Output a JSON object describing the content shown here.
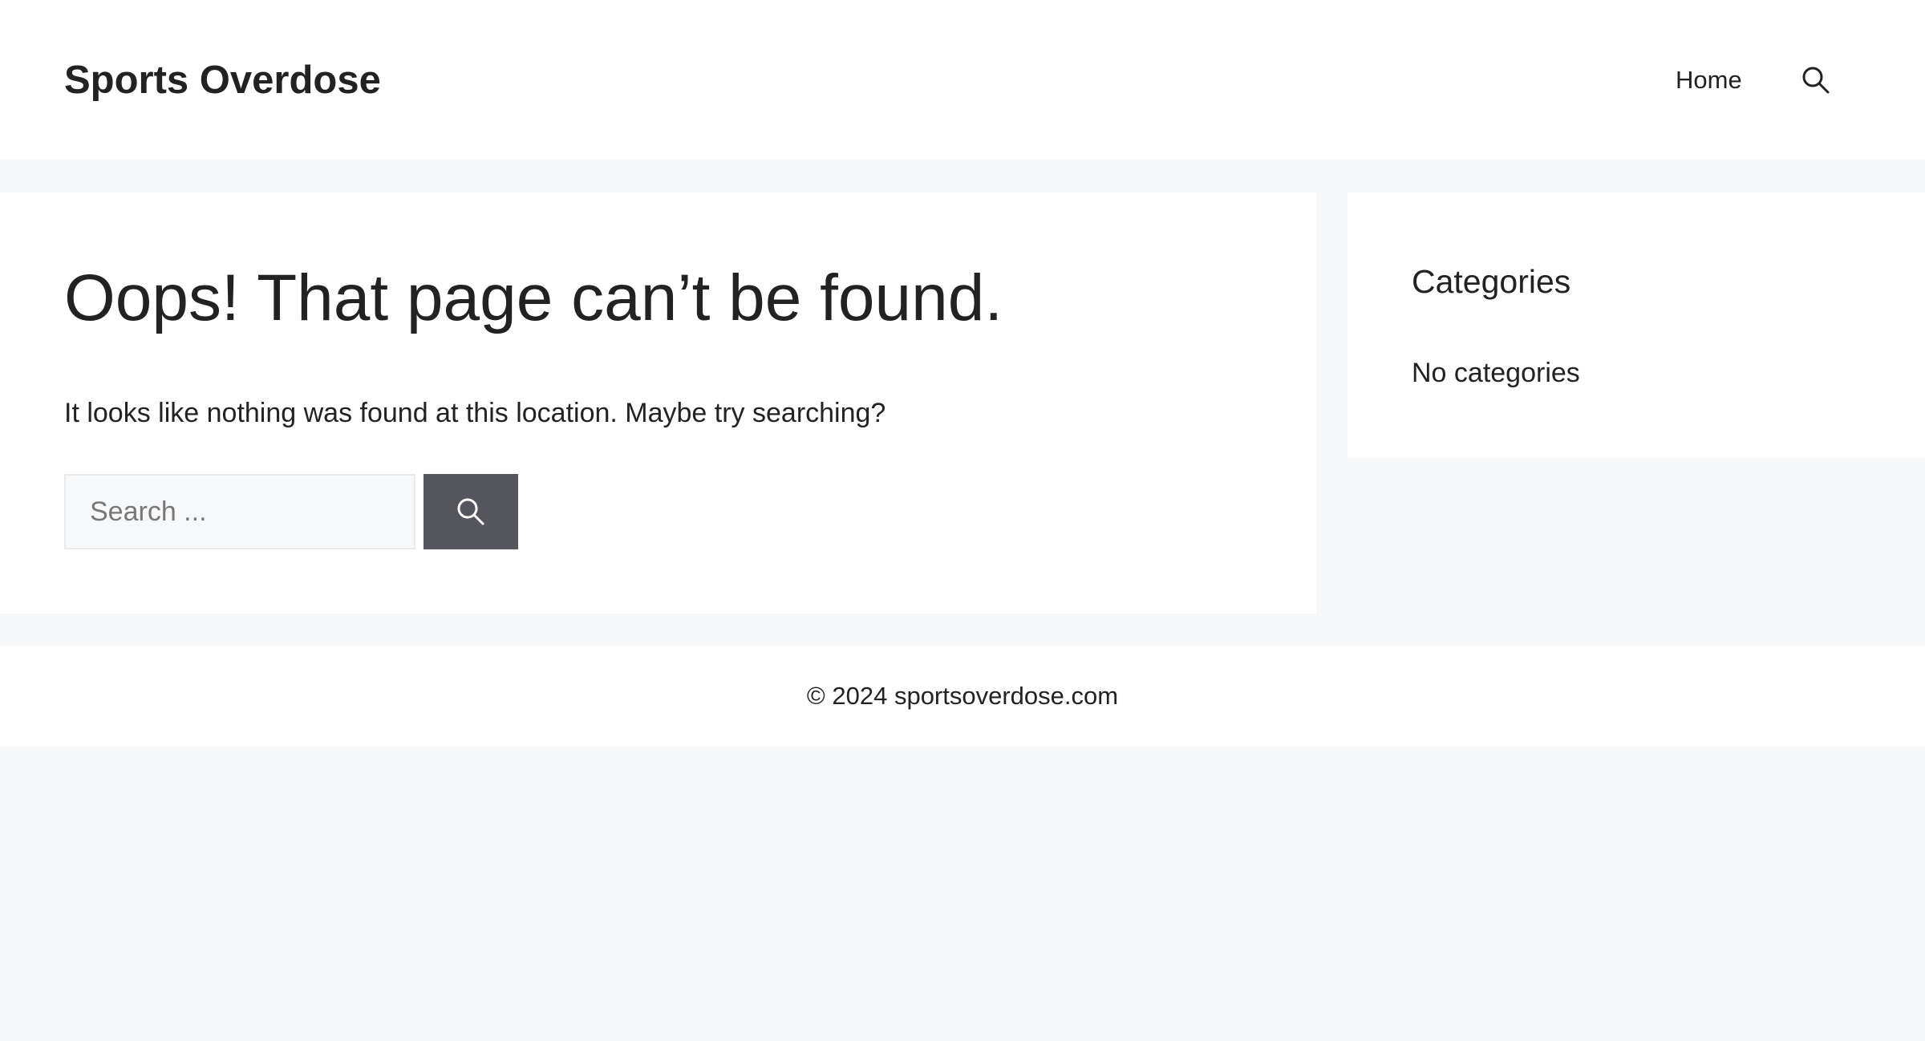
{
  "header": {
    "site_title": "Sports Overdose",
    "nav": {
      "home_label": "Home",
      "search_icon": "search-icon"
    }
  },
  "main": {
    "title": "Oops! That page can’t be found.",
    "message": "It looks like nothing was found at this location. Maybe try searching?",
    "search": {
      "placeholder": "Search ...",
      "value": "",
      "submit_icon": "search-icon"
    }
  },
  "sidebar": {
    "widget_title": "Categories",
    "empty_text": "No categories"
  },
  "footer": {
    "copyright": "© 2024 sportsoverdose.com"
  },
  "colors": {
    "page_background": "#f6f7f9",
    "text": "#222222",
    "search_button": "#55555e",
    "search_field_background": "#f7f8f9"
  }
}
